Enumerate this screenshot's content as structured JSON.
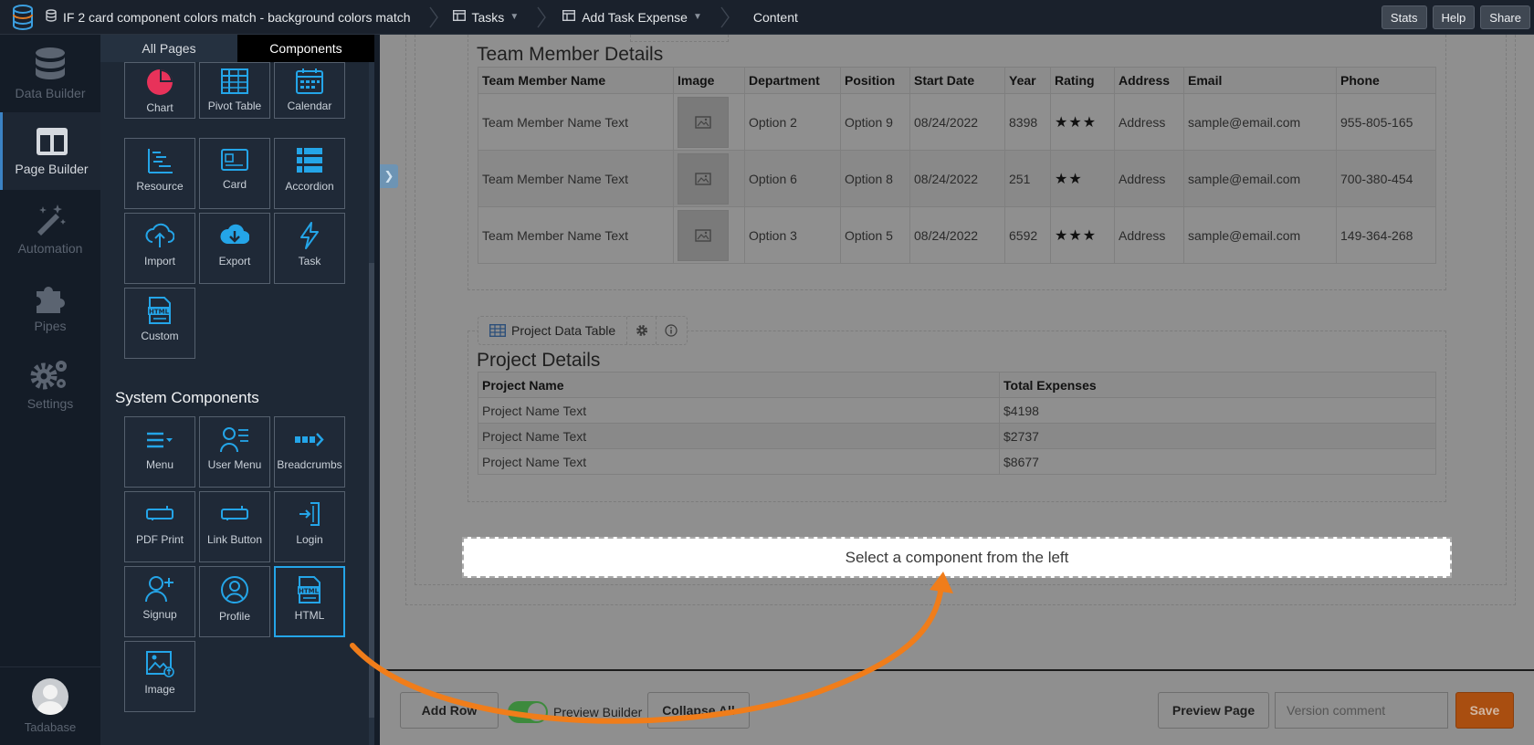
{
  "topbar": {
    "app_title": "IF 2 card component colors match - background colors match",
    "crumb_tasks": "Tasks",
    "crumb_page": "Add Task Expense",
    "crumb_content": "Content",
    "stats": "Stats",
    "help": "Help",
    "share": "Share"
  },
  "leftnav": {
    "items": [
      {
        "label": "Data Builder"
      },
      {
        "label": "Page Builder"
      },
      {
        "label": "Automation"
      },
      {
        "label": "Pipes"
      },
      {
        "label": "Settings"
      }
    ],
    "user": "Tadabase"
  },
  "panel": {
    "tab_all_pages": "All Pages",
    "tab_components": "Components",
    "components": [
      "Chart",
      "Pivot Table",
      "Calendar",
      "Resource",
      "Card",
      "Accordion",
      "Import",
      "Export",
      "Task",
      "Custom"
    ],
    "system_title": "System Components",
    "system_components": [
      "Menu",
      "User Menu",
      "Breadcrumbs",
      "PDF Print",
      "Link Button",
      "Login",
      "Signup",
      "Profile",
      "HTML",
      "Image"
    ]
  },
  "team": {
    "title": "Team Member Details",
    "headers": [
      "Team Member Name",
      "Image",
      "Department",
      "Position",
      "Start Date",
      "Year",
      "Rating",
      "Address",
      "Email",
      "Phone"
    ],
    "rows": [
      {
        "name": "Team Member Name Text",
        "department": "Option 2",
        "position": "Option 9",
        "start": "08/24/2022",
        "year": "8398",
        "rating": "★★★",
        "address": "Address",
        "email": "sample@email.com",
        "phone": "955-805-165"
      },
      {
        "name": "Team Member Name Text",
        "department": "Option 6",
        "position": "Option 8",
        "start": "08/24/2022",
        "year": "251",
        "rating": "★★",
        "address": "Address",
        "email": "sample@email.com",
        "phone": "700-380-454"
      },
      {
        "name": "Team Member Name Text",
        "department": "Option 3",
        "position": "Option 5",
        "start": "08/24/2022",
        "year": "6592",
        "rating": "★★★",
        "address": "Address",
        "email": "sample@email.com",
        "phone": "149-364-268"
      }
    ]
  },
  "project": {
    "toolbar_label": "Project Data Table",
    "title": "Project Details",
    "headers": [
      "Project Name",
      "Total Expenses"
    ],
    "rows": [
      {
        "name": "Project Name Text",
        "expense": "$4198"
      },
      {
        "name": "Project Name Text",
        "expense": "$2737"
      },
      {
        "name": "Project Name Text",
        "expense": "$8677"
      }
    ]
  },
  "dropzone": "Select a component from the left",
  "bottombar": {
    "add_row": "Add Row",
    "preview_builder": "Preview Builder",
    "collapse_all": "Collapse All",
    "preview_page": "Preview Page",
    "version_placeholder": "Version comment",
    "save": "Save"
  },
  "colors": {
    "accent": "#24a5e8",
    "save": "#a94e10",
    "arrow": "#f07d1a",
    "chart_icon": "#e8325a"
  }
}
